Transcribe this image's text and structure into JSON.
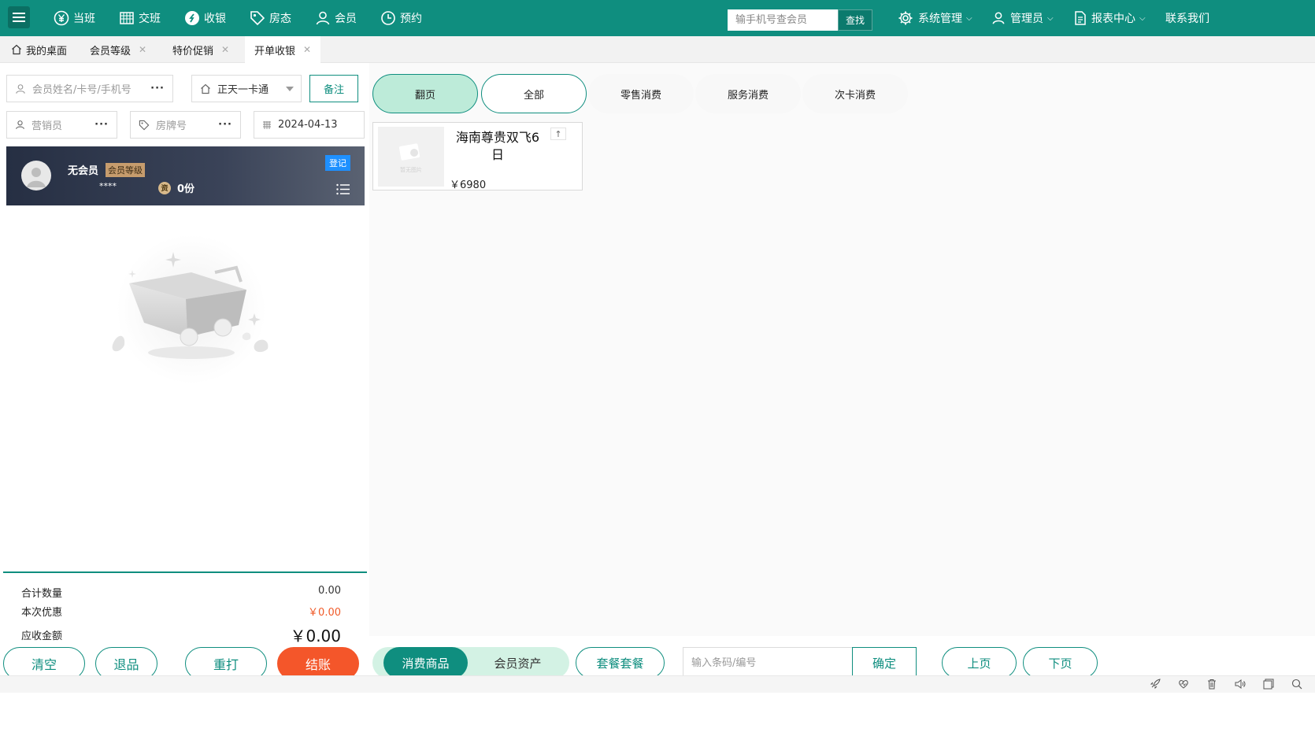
{
  "nav": [
    {
      "label": "当班",
      "icon": "yen-circle-icon"
    },
    {
      "label": "交班",
      "icon": "calendar-grid-icon"
    },
    {
      "label": "收银",
      "icon": "cashier-icon"
    },
    {
      "label": "房态",
      "icon": "tag-icon"
    },
    {
      "label": "会员",
      "icon": "user-icon"
    },
    {
      "label": "预约",
      "icon": "clock-icon"
    }
  ],
  "header": {
    "search_placeholder": "输手机号查会员",
    "search_button": "查找",
    "system_label": "系统管理",
    "admin_label": "管理员",
    "report_label": "报表中心",
    "contact_label": "联系我们"
  },
  "tabs": [
    {
      "label": "我的桌面"
    },
    {
      "label": "会员等级"
    },
    {
      "label": "特价促销"
    },
    {
      "label": "开单收银"
    }
  ],
  "left": {
    "member_placeholder": "会员姓名/卡号/手机号",
    "card_type": "正天一卡通",
    "note_button": "备注",
    "sales_placeholder": "营销员",
    "room_placeholder": "房牌号",
    "date": "2024-04-13",
    "dots": "···"
  },
  "member_card": {
    "name": "无会员",
    "level": "会员等级",
    "stars": "****",
    "points": "0份",
    "register": "登记",
    "coin_label": "资"
  },
  "summary": {
    "qty_label": "合计数量",
    "qty_value": "0.00",
    "discount_label": "本次优惠",
    "discount_value": "￥0.00",
    "due_label": "应收金额",
    "due_value": "￥0.00"
  },
  "bottom_left": {
    "clear": "清空",
    "return": "退品",
    "reprint": "重打",
    "checkout": "结账"
  },
  "categories": [
    {
      "label": "翻页"
    },
    {
      "label": "全部"
    },
    {
      "label": "零售消费"
    },
    {
      "label": "服务消费"
    },
    {
      "label": "次卡消费"
    }
  ],
  "product": {
    "name": "海南尊贵双飞6日",
    "price": "￥6980",
    "up": "↑",
    "thumb_label": "暂无图片"
  },
  "bottom_right": {
    "consume_goods": "消费商品",
    "member_assets": "会员资产",
    "package": "套餐套餐",
    "code_placeholder": "输入条码/编号",
    "confirm": "确定",
    "prev": "上页",
    "next": "下页"
  },
  "colors": {
    "brand": "#0f8e7f",
    "checkout": "#f4562a",
    "discount": "#f05a28"
  }
}
